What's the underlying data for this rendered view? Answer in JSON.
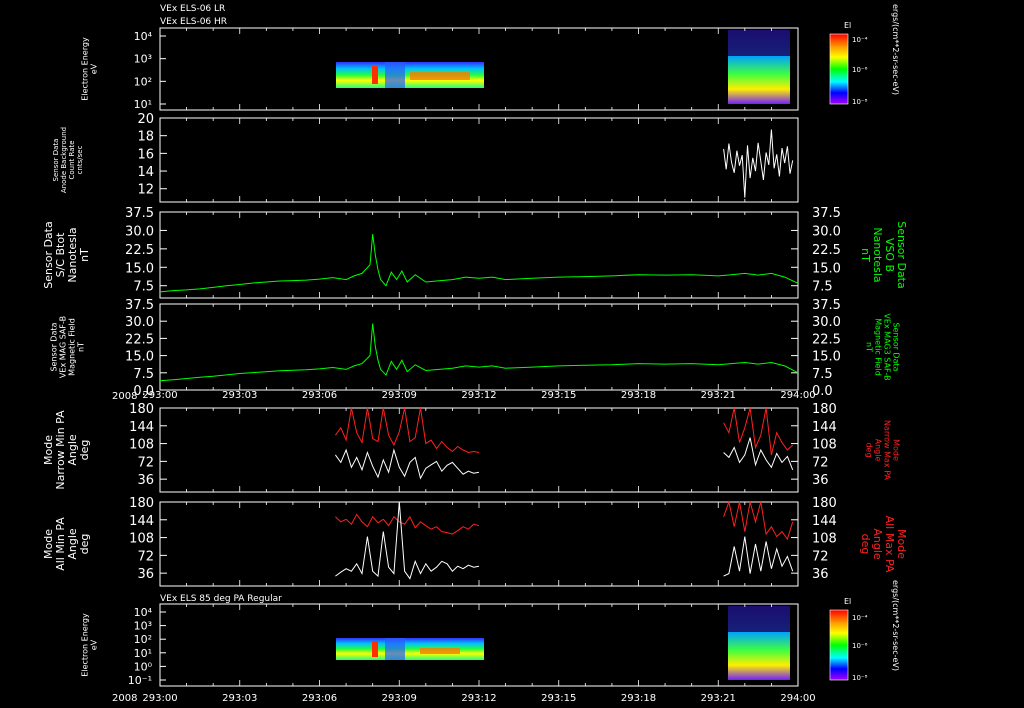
{
  "header": {
    "line1": "VEx ELS-06 LR",
    "line2": "VEx ELS-06 HR"
  },
  "spec_bottom_title": "VEx ELS 85 deg PA Regular",
  "year_label": "2008",
  "colors": {
    "bg": "#000000",
    "green": "#00ff00",
    "red": "#ff2020",
    "white": "#ffffff"
  },
  "colorbar": {
    "title": "El",
    "ticks_top": [
      "10⁻⁴",
      "10⁻⁶",
      "10⁻⁸"
    ],
    "ticks_bottom": [
      "10⁻⁴",
      "10⁻⁶",
      "10⁻⁸"
    ],
    "unit": "ergs/(cm**2-sr-sec-eV)"
  },
  "chart_data": [
    {
      "type": "heatmap",
      "panel": "p1",
      "ylabel": [
        "Electron Energy",
        "eV"
      ],
      "y_tick_labels": [
        "10⁴",
        "10³",
        "10²",
        "10¹"
      ],
      "x_tick_labels": [
        "293:00",
        "293:03",
        "293:06",
        "293:09",
        "293:12",
        "293:15",
        "293:18",
        "293:21",
        "294:00"
      ],
      "data_intervals": [
        [
          "293:06.5",
          "293:12.0"
        ],
        [
          "293:21.2",
          "293:23.8"
        ]
      ]
    },
    {
      "type": "line",
      "panel": "p2",
      "ylabel": [
        "Sensor Data",
        "Anode Background",
        "Count Rate",
        "cnts/sec"
      ],
      "y_ticks": [
        12,
        14,
        16,
        18,
        20
      ],
      "ylim": [
        10.5,
        20
      ],
      "series": [
        {
          "color": "white",
          "x": [
            21.2,
            21.3,
            21.4,
            21.5,
            21.6,
            21.7,
            21.8,
            21.9,
            22.0,
            22.1,
            22.2,
            22.3,
            22.4,
            22.5,
            22.6,
            22.7,
            22.8,
            22.9,
            23.0,
            23.1,
            23.2,
            23.3,
            23.4,
            23.5,
            23.6,
            23.7,
            23.8
          ],
          "y": [
            16.5,
            14.2,
            17.1,
            15.0,
            13.8,
            16.3,
            14.6,
            15.8,
            11.0,
            16.9,
            13.2,
            15.5,
            14.0,
            17.2,
            15.1,
            13.0,
            16.1,
            14.7,
            18.7,
            14.3,
            15.9,
            13.4,
            16.6,
            14.9,
            16.8,
            13.7,
            15.2
          ]
        }
      ]
    },
    {
      "type": "line",
      "panel": "p3",
      "ylabel": [
        "Sensor Data",
        "S/C Btot",
        "Nanotesla",
        "nT"
      ],
      "ylabel_right": [
        "Sensor Data",
        "VSO B",
        "Nanotesla",
        "nT"
      ],
      "y_ticks": [
        7.5,
        15.0,
        22.5,
        30.0,
        37.5
      ],
      "ylim": [
        2.5,
        37.5
      ],
      "series": [
        {
          "color": "green",
          "x": [
            0,
            0.5,
            1,
            1.5,
            2,
            2.5,
            3,
            3.5,
            4,
            4.5,
            5,
            5.5,
            6,
            6.5,
            7,
            7.3,
            7.6,
            7.9,
            8.0,
            8.1,
            8.2,
            8.3,
            8.5,
            8.7,
            8.9,
            9.1,
            9.3,
            9.6,
            10,
            10.5,
            11,
            11.5,
            12,
            12.5,
            13,
            14,
            15,
            16,
            17,
            18,
            19,
            20,
            21,
            21.5,
            22,
            22.5,
            23,
            23.5,
            24
          ],
          "y": [
            5.0,
            5.5,
            5.8,
            6.2,
            6.8,
            7.5,
            8.0,
            8.6,
            9.0,
            9.4,
            9.6,
            9.8,
            10.2,
            10.8,
            10.0,
            11.5,
            12.5,
            16.0,
            28.5,
            20.0,
            14.0,
            10.0,
            7.5,
            13.0,
            10.0,
            13.5,
            9.0,
            12.0,
            9.0,
            9.5,
            10.0,
            11.0,
            10.5,
            11.0,
            10.0,
            10.5,
            11.0,
            11.2,
            11.5,
            12.0,
            11.8,
            12.0,
            11.5,
            12.0,
            12.5,
            11.8,
            12.5,
            11.0,
            8.5
          ]
        }
      ]
    },
    {
      "type": "line",
      "panel": "p4",
      "ylabel": [
        "Sensor Data",
        "VEx MAG SAF-B",
        "Magnetic Field",
        "nT"
      ],
      "ylabel_right": [
        "Sensor Data",
        "VEx MAG3 SAF-B",
        "Magnetic Field",
        "nT"
      ],
      "y_ticks": [
        0.0,
        7.5,
        15.0,
        22.5,
        30.0,
        37.5
      ],
      "ylim": [
        0,
        37.5
      ],
      "series": [
        {
          "color": "green",
          "x": [
            0,
            0.5,
            1,
            1.5,
            2,
            2.5,
            3,
            3.5,
            4,
            4.5,
            5,
            5.5,
            6,
            6.5,
            7,
            7.3,
            7.6,
            7.9,
            8.0,
            8.1,
            8.2,
            8.3,
            8.5,
            8.7,
            8.9,
            9.1,
            9.3,
            9.6,
            10,
            10.5,
            11,
            11.5,
            12,
            12.5,
            13,
            14,
            15,
            16,
            17,
            18,
            19,
            20,
            21,
            21.5,
            22,
            22.5,
            23,
            23.5,
            24
          ],
          "y": [
            4.0,
            4.5,
            5.0,
            5.6,
            6.0,
            6.6,
            7.2,
            7.6,
            8.0,
            8.4,
            8.6,
            8.8,
            9.2,
            9.8,
            9.0,
            10.5,
            11.5,
            15.0,
            29.0,
            19.0,
            13.0,
            9.0,
            6.5,
            12.5,
            9.0,
            13.0,
            8.0,
            11.0,
            8.5,
            9.0,
            9.5,
            10.5,
            10.0,
            10.5,
            9.5,
            10.0,
            10.5,
            10.8,
            11.0,
            11.5,
            11.3,
            11.5,
            11.0,
            11.5,
            12.0,
            11.3,
            12.0,
            10.5,
            7.5
          ]
        }
      ]
    },
    {
      "type": "line",
      "panel": "p5",
      "ylabel": [
        "Mode",
        "Narrow Min PA",
        "Angle",
        "deg"
      ],
      "ylabel_right": [
        "Mode",
        "Narrow Max PA",
        "Angle",
        "deg"
      ],
      "y_ticks": [
        36,
        72,
        108,
        144,
        180
      ],
      "ylim": [
        10,
        180
      ],
      "series": [
        {
          "color": "red",
          "x": [
            6.6,
            6.8,
            7.0,
            7.2,
            7.4,
            7.6,
            7.8,
            8.0,
            8.2,
            8.4,
            8.6,
            8.8,
            9.0,
            9.2,
            9.4,
            9.6,
            9.8,
            10.0,
            10.2,
            10.4,
            10.6,
            10.8,
            11.0,
            11.2,
            11.4,
            11.6,
            11.8,
            12.0
          ],
          "y": [
            125,
            140,
            115,
            180,
            130,
            110,
            180,
            118,
            112,
            180,
            125,
            105,
            132,
            180,
            112,
            120,
            180,
            108,
            115,
            98,
            112,
            100,
            92,
            102,
            95,
            90,
            92,
            90
          ]
        },
        {
          "color": "red",
          "x": [
            21.2,
            21.4,
            21.6,
            21.8,
            22.0,
            22.2,
            22.4,
            22.6,
            22.8,
            23.0,
            23.2,
            23.4,
            23.6,
            23.8
          ],
          "y": [
            150,
            130,
            180,
            110,
            140,
            180,
            100,
            125,
            180,
            85,
            130,
            110,
            95,
            105
          ]
        },
        {
          "color": "white",
          "x": [
            6.6,
            6.8,
            7.0,
            7.2,
            7.4,
            7.6,
            7.8,
            8.0,
            8.2,
            8.4,
            8.6,
            8.8,
            9.0,
            9.2,
            9.4,
            9.6,
            9.8,
            10.0,
            10.2,
            10.4,
            10.6,
            10.8,
            11.0,
            11.2,
            11.4,
            11.6,
            11.8,
            12.0
          ],
          "y": [
            85,
            70,
            95,
            60,
            80,
            55,
            90,
            62,
            40,
            75,
            50,
            95,
            60,
            42,
            70,
            80,
            38,
            58,
            65,
            72,
            52,
            64,
            70,
            58,
            46,
            52,
            48,
            50
          ]
        },
        {
          "color": "white",
          "x": [
            21.2,
            21.4,
            21.6,
            21.8,
            22.0,
            22.2,
            22.4,
            22.6,
            22.8,
            23.0,
            23.2,
            23.4,
            23.6,
            23.8
          ],
          "y": [
            90,
            80,
            100,
            70,
            85,
            120,
            65,
            95,
            75,
            60,
            88,
            70,
            82,
            55
          ]
        }
      ]
    },
    {
      "type": "line",
      "panel": "p6",
      "ylabel": [
        "Mode",
        "All Min PA",
        "Angle",
        "deg"
      ],
      "ylabel_right": [
        "Mode",
        "All Max PA",
        "Angle",
        "deg"
      ],
      "y_ticks": [
        36,
        72,
        108,
        144,
        180
      ],
      "ylim": [
        10,
        180
      ],
      "series": [
        {
          "color": "red",
          "x": [
            6.6,
            6.8,
            7.0,
            7.2,
            7.4,
            7.6,
            7.8,
            8.0,
            8.2,
            8.4,
            8.6,
            8.8,
            9.0,
            9.2,
            9.4,
            9.6,
            9.8,
            10.0,
            10.2,
            10.4,
            10.6,
            10.8,
            11.0,
            11.2,
            11.4,
            11.6,
            11.8,
            12.0
          ],
          "y": [
            150,
            140,
            145,
            135,
            155,
            140,
            130,
            150,
            138,
            145,
            132,
            150,
            140,
            135,
            150,
            128,
            140,
            132,
            125,
            130,
            120,
            118,
            115,
            122,
            130,
            125,
            135,
            132
          ]
        },
        {
          "color": "red",
          "x": [
            21.2,
            21.4,
            21.6,
            21.8,
            22.0,
            22.2,
            22.4,
            22.6,
            22.8,
            23.0,
            23.2,
            23.4,
            23.6,
            23.8
          ],
          "y": [
            150,
            180,
            130,
            180,
            120,
            180,
            140,
            180,
            115,
            130,
            110,
            120,
            105,
            140
          ]
        },
        {
          "color": "white",
          "x": [
            6.6,
            6.8,
            7.0,
            7.2,
            7.4,
            7.6,
            7.8,
            8.0,
            8.2,
            8.4,
            8.6,
            8.8,
            9.0,
            9.2,
            9.4,
            9.6,
            9.8,
            10.0,
            10.2,
            10.4,
            10.6,
            10.8,
            11.0,
            11.2,
            11.4,
            11.6,
            11.8,
            12.0
          ],
          "y": [
            30,
            38,
            45,
            40,
            55,
            35,
            110,
            40,
            30,
            120,
            48,
            35,
            180,
            40,
            25,
            60,
            35,
            55,
            40,
            48,
            60,
            55,
            40,
            50,
            45,
            52,
            48,
            50
          ]
        },
        {
          "color": "white",
          "x": [
            21.2,
            21.4,
            21.6,
            21.8,
            22.0,
            22.2,
            22.4,
            22.6,
            22.8,
            23.0,
            23.2,
            23.4,
            23.6,
            23.8
          ],
          "y": [
            30,
            35,
            90,
            40,
            110,
            35,
            95,
            40,
            100,
            45,
            85,
            50,
            70,
            40
          ]
        }
      ]
    },
    {
      "type": "heatmap",
      "panel": "p7",
      "ylabel": [
        "Electron Energy",
        "eV"
      ],
      "y_tick_labels": [
        "10⁴",
        "10³",
        "10²",
        "10¹",
        "10⁰",
        "10⁻¹"
      ],
      "x_tick_labels": [
        "293:00",
        "293:03",
        "293:06",
        "293:09",
        "293:12",
        "293:15",
        "293:18",
        "293:21",
        "294:00"
      ],
      "data_intervals": [
        [
          "293:06.5",
          "293:12.0"
        ],
        [
          "293:21.2",
          "293:23.8"
        ]
      ]
    }
  ]
}
